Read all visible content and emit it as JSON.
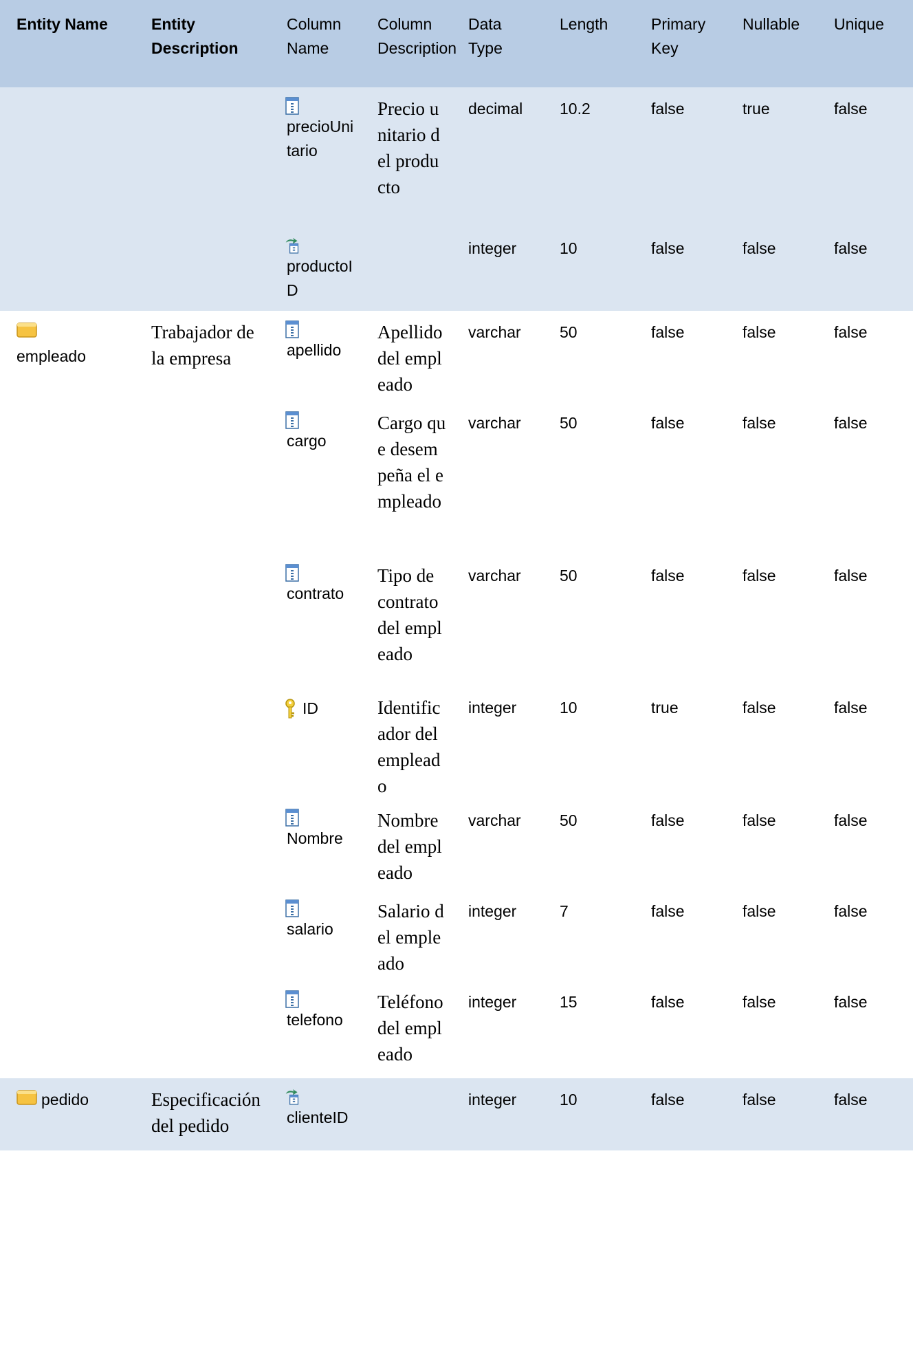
{
  "headers": {
    "entity_name": "Entity Name",
    "entity_description": "Entity Description",
    "column_name": "Column Name",
    "column_description": "Column Description",
    "data_type": "Data Type",
    "length": "Length",
    "primary_key": "Primary Key",
    "nullable": "Nullable",
    "unique": "Unique"
  },
  "rows": [
    {
      "entity": "",
      "entity_desc": "",
      "column": "precioUnitario",
      "col_icon": "column-icon",
      "col_desc": "Precio unitario del producto",
      "type": "decimal",
      "length": "10.2",
      "pk": "false",
      "nullable": "true",
      "unique": "false"
    },
    {
      "entity": "",
      "entity_desc": "",
      "column": "productoID",
      "col_icon": "foreign-key-icon",
      "col_desc": "",
      "type": "integer",
      "length": "10",
      "pk": "false",
      "nullable": "false",
      "unique": "false"
    },
    {
      "entity": "empleado",
      "entity_desc": "Trabajador de la empresa",
      "column": "apellido",
      "col_icon": "column-icon",
      "col_desc": "Apellido del empleado",
      "type": "varchar",
      "length": "50",
      "pk": "false",
      "nullable": "false",
      "unique": "false"
    },
    {
      "entity": "",
      "entity_desc": "",
      "column": "cargo",
      "col_icon": "column-icon",
      "col_desc": "Cargo que desempeña el empleado",
      "type": "varchar",
      "length": "50",
      "pk": "false",
      "nullable": "false",
      "unique": "false"
    },
    {
      "entity": "",
      "entity_desc": "",
      "column": "contrato",
      "col_icon": "column-icon",
      "col_desc": "Tipo de contrato del empleado",
      "type": "varchar",
      "length": "50",
      "pk": "false",
      "nullable": "false",
      "unique": "false"
    },
    {
      "entity": "",
      "entity_desc": "",
      "column": "ID",
      "col_icon": "key-icon",
      "col_desc": "Identificador del empleado",
      "type": "integer",
      "length": "10",
      "pk": "true",
      "nullable": "false",
      "unique": "false"
    },
    {
      "entity": "",
      "entity_desc": "",
      "column": "Nombre",
      "col_icon": "column-icon",
      "col_desc": "Nombre del empleado",
      "type": "varchar",
      "length": "50",
      "pk": "false",
      "nullable": "false",
      "unique": "false"
    },
    {
      "entity": "",
      "entity_desc": "",
      "column": "salario",
      "col_icon": "column-icon",
      "col_desc": "Salario del empleado",
      "type": "integer",
      "length": "7",
      "pk": "false",
      "nullable": "false",
      "unique": "false"
    },
    {
      "entity": "",
      "entity_desc": "",
      "column": "telefono",
      "col_icon": "column-icon",
      "col_desc": "Teléfono del empleado",
      "type": "integer",
      "length": "15",
      "pk": "false",
      "nullable": "false",
      "unique": "false"
    },
    {
      "entity": "pedido",
      "entity_desc": "Especificación del pedido",
      "column": "clienteID",
      "col_icon": "foreign-key-icon",
      "col_desc": "",
      "type": "integer",
      "length": "10",
      "pk": "false",
      "nullable": "false",
      "unique": "false"
    }
  ],
  "colors": {
    "header_bg": "#b8cce4",
    "band_bg": "#dbe5f1",
    "entity_icon": "#f6c342"
  }
}
